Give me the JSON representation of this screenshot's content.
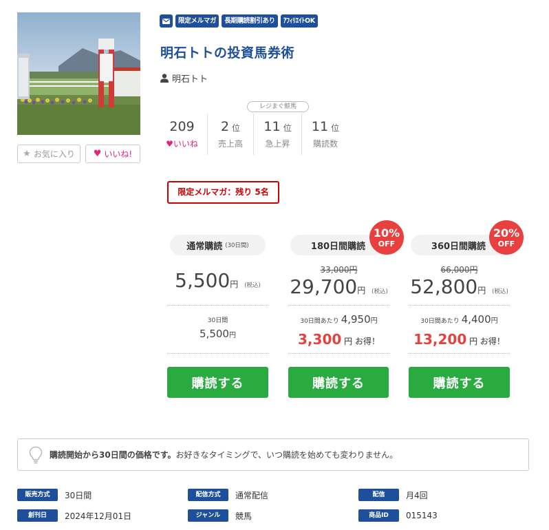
{
  "product": {
    "title": "明石トトの投資馬券術",
    "author": "明石トト",
    "badges": [
      "限定メルマガ",
      "長期購読割引あり",
      "ｱﾌｨﾘｴｲﾄOK"
    ],
    "favorite_label": "お気に入り",
    "like_label": "いいね!"
  },
  "stats": {
    "likes": {
      "value": "209",
      "label": "いいね"
    },
    "sales": {
      "value": "2",
      "unit": "位",
      "label": "売上高"
    },
    "rising": {
      "value": "11",
      "unit": "位",
      "label": "急上昇"
    },
    "readers": {
      "value": "11",
      "unit": "位",
      "label": "購読数"
    },
    "ranking_category": "レジまぐ競馬"
  },
  "limited_notice": "限定メルマガ：残り 5名",
  "plans": [
    {
      "name": "通常購読",
      "period_note": "(30日間)",
      "price": "5,500",
      "yen": "円",
      "tax": "(税込)",
      "sub_label": "30日間",
      "sub_price": "5,500",
      "sub_yen": "円",
      "button": "購読する"
    },
    {
      "name": "180日間購読",
      "discount": "10%",
      "off": "OFF",
      "original_price": "33,000円",
      "price": "29,700",
      "yen": "円",
      "tax": "(税込)",
      "per_label": "30日間あたり",
      "per_price": "4,950",
      "per_yen": "円",
      "saving": "3,300",
      "saving_yen": "円",
      "saving_text": "お得！",
      "button": "購読する"
    },
    {
      "name": "360日間購読",
      "discount": "20%",
      "off": "OFF",
      "original_price": "66,000円",
      "price": "52,800",
      "yen": "円",
      "tax": "(税込)",
      "per_label": "30日間あたり",
      "per_price": "4,400",
      "per_yen": "円",
      "saving": "13,200",
      "saving_yen": "円",
      "saving_text": "お得！",
      "button": "購読する"
    }
  ],
  "info": {
    "bold": "購読開始から30日間の価格です。",
    "text": "お好きなタイミングで、いつ購読を始めても変わりません。"
  },
  "meta": {
    "sale_type": {
      "label": "販売方式",
      "value": "30日間"
    },
    "delivery_type": {
      "label": "配信方式",
      "value": "通常配信"
    },
    "delivery": {
      "label": "配信",
      "value": "月4回"
    },
    "founded": {
      "label": "創刊日",
      "value": "2024年12月01日"
    },
    "genre": {
      "label": "ジャンル",
      "value": "競馬"
    },
    "product_id": {
      "label": "商品ID",
      "value": "015143"
    }
  },
  "colors": {
    "brand_blue": "#1e4f9c",
    "buy_green": "#2aab3f",
    "discount_red": "#e8403e",
    "like_pink": "#e3247a",
    "alert_red": "#cc0000"
  }
}
